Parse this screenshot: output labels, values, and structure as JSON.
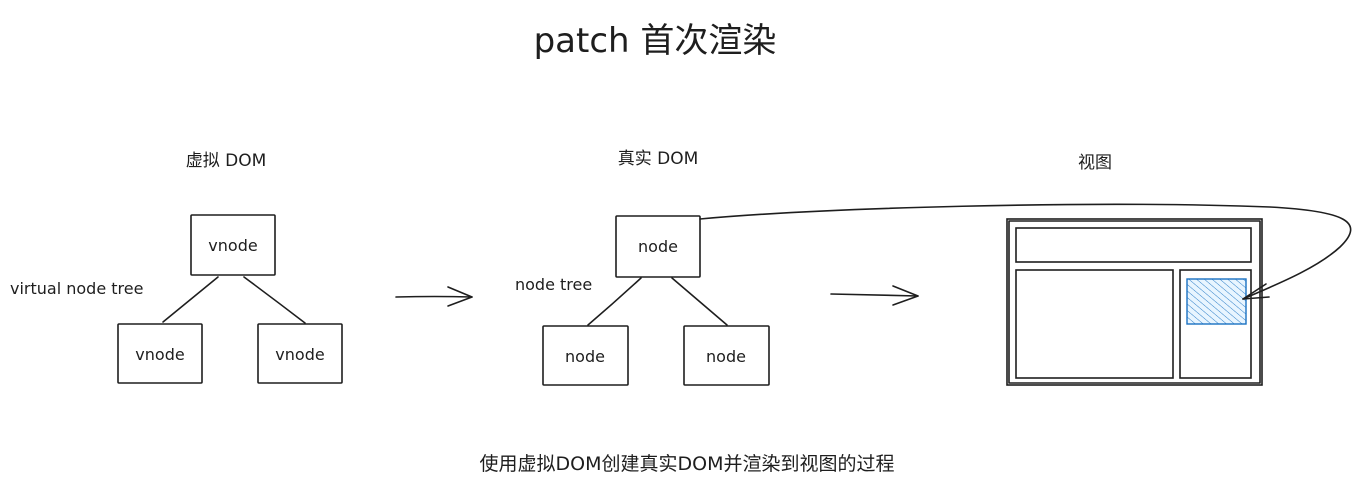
{
  "title": "patch 首次渲染",
  "sections": {
    "virtual": {
      "label": "虚拟 DOM",
      "tree_label": "virtual node tree",
      "root": "vnode",
      "left_child": "vnode",
      "right_child": "vnode"
    },
    "real": {
      "label": "真实 DOM",
      "tree_label": "node tree",
      "root": "node",
      "left_child": "node",
      "right_child": "node"
    },
    "view": {
      "label": "视图"
    }
  },
  "caption": "使用虚拟DOM创建真实DOM并渲染到视图的过程",
  "colors": {
    "stroke": "#1e1e1e",
    "highlight": "#1971c2",
    "highlight_fill": "#a5d8ff"
  }
}
